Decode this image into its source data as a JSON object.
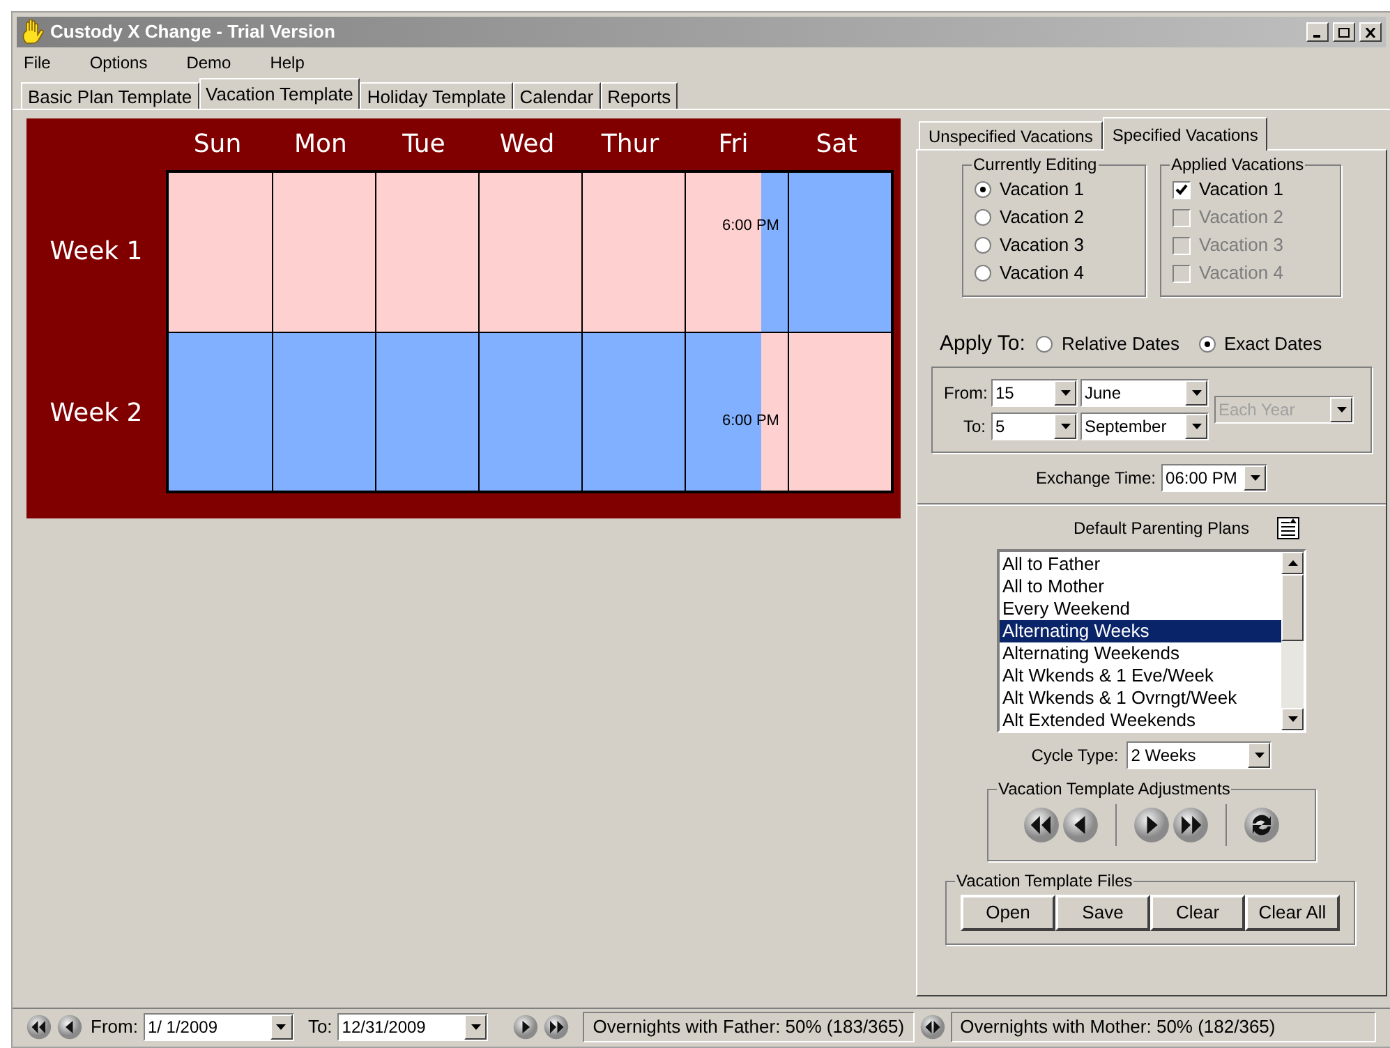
{
  "window": {
    "title": "Custody X Change - Trial Version"
  },
  "menu": [
    "File",
    "Options",
    "Demo",
    "Help"
  ],
  "tabs": [
    {
      "label": "Basic Plan Template",
      "selected": false
    },
    {
      "label": "Vacation Template",
      "selected": true
    },
    {
      "label": "Holiday Template",
      "selected": false
    },
    {
      "label": "Calendar",
      "selected": false
    },
    {
      "label": "Reports",
      "selected": false
    }
  ],
  "calendar": {
    "days": [
      "Sun",
      "Mon",
      "Tue",
      "Wed",
      "Thur",
      "Fri",
      "Sat"
    ],
    "weeks": [
      {
        "label": "Week 1",
        "days": [
          {
            "segments": [
              {
                "color": "#ffd0d0"
              }
            ]
          },
          {
            "segments": [
              {
                "color": "#ffd0d0"
              }
            ]
          },
          {
            "segments": [
              {
                "color": "#ffd0d0"
              }
            ]
          },
          {
            "segments": [
              {
                "color": "#ffd0d0"
              }
            ]
          },
          {
            "segments": [
              {
                "color": "#ffd0d0"
              }
            ]
          },
          {
            "exchange": "6:00 PM",
            "segments": [
              {
                "color": "#ffd0d0"
              },
              {
                "color": "#80b0ff"
              }
            ]
          },
          {
            "segments": [
              {
                "color": "#80b0ff"
              }
            ]
          }
        ]
      },
      {
        "label": "Week 2",
        "days": [
          {
            "segments": [
              {
                "color": "#80b0ff"
              }
            ]
          },
          {
            "segments": [
              {
                "color": "#80b0ff"
              }
            ]
          },
          {
            "segments": [
              {
                "color": "#80b0ff"
              }
            ]
          },
          {
            "segments": [
              {
                "color": "#80b0ff"
              }
            ]
          },
          {
            "segments": [
              {
                "color": "#80b0ff"
              }
            ]
          },
          {
            "exchange": "6:00 PM",
            "segments": [
              {
                "color": "#80b0ff"
              },
              {
                "color": "#ffd0d0"
              }
            ]
          },
          {
            "segments": [
              {
                "color": "#ffd0d0"
              }
            ]
          }
        ]
      }
    ]
  },
  "side_tabs": [
    {
      "label": "Unspecified Vacations",
      "selected": false
    },
    {
      "label": "Specified Vacations",
      "selected": true
    }
  ],
  "currently_editing": {
    "title": "Currently Editing",
    "options": [
      {
        "label": "Vacation 1",
        "selected": true
      },
      {
        "label": "Vacation 2",
        "selected": false
      },
      {
        "label": "Vacation 3",
        "selected": false
      },
      {
        "label": "Vacation 4",
        "selected": false
      }
    ]
  },
  "applied_vacations": {
    "title": "Applied Vacations",
    "items": [
      {
        "label": "Vacation 1",
        "checked": true,
        "disabled": false
      },
      {
        "label": "Vacation 2",
        "checked": false,
        "disabled": true
      },
      {
        "label": "Vacation 3",
        "checked": false,
        "disabled": true
      },
      {
        "label": "Vacation 4",
        "checked": false,
        "disabled": true
      }
    ]
  },
  "apply_to": {
    "label": "Apply To:",
    "options": [
      {
        "label": "Relative Dates",
        "selected": false
      },
      {
        "label": "Exact Dates",
        "selected": true
      }
    ]
  },
  "date_range": {
    "from_label": "From:",
    "from_day": "15",
    "from_month": "June",
    "to_label": "To:",
    "to_day": "5",
    "to_month": "September",
    "repeat": {
      "value": "Each Year",
      "disabled": true
    }
  },
  "exchange_time": {
    "label": "Exchange Time:",
    "value": "06:00 PM"
  },
  "parenting_plans": {
    "title": "Default Parenting Plans",
    "items": [
      {
        "label": "All to Father",
        "selected": false
      },
      {
        "label": "All to Mother",
        "selected": false
      },
      {
        "label": "Every Weekend",
        "selected": false
      },
      {
        "label": "Alternating Weeks",
        "selected": true
      },
      {
        "label": "Alternating Weekends",
        "selected": false
      },
      {
        "label": "Alt Wkends & 1 Eve/Week",
        "selected": false
      },
      {
        "label": "Alt Wkends & 1 Ovrngt/Week",
        "selected": false
      },
      {
        "label": "Alt Extended Weekends",
        "selected": false
      }
    ]
  },
  "cycle_type": {
    "label": "Cycle Type:",
    "value": "2 Weeks"
  },
  "adjustments": {
    "title": "Vacation Template Adjustments"
  },
  "files": {
    "title": "Vacation Template Files",
    "buttons": [
      "Open",
      "Save",
      "Clear",
      "Clear All"
    ]
  },
  "status_bar": {
    "from_label": "From:",
    "from_value": "1/ 1/2009",
    "to_label": "To:",
    "to_value": "12/31/2009",
    "father_text": "Overnights with Father: 50% (183/365)",
    "mother_text": "Overnights with Mother: 50% (182/365)"
  }
}
